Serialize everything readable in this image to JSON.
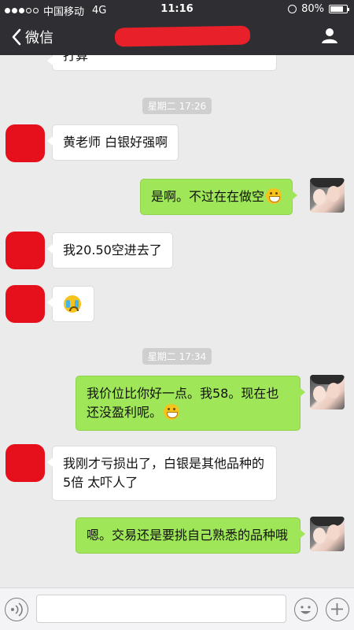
{
  "status_bar": {
    "carrier": "中国移动",
    "network": "4G",
    "time": "11:16",
    "battery": "80%",
    "battery_level": 0.8,
    "signal_icon": "signal-dots-icon",
    "alarm_icon": "alarm-icon",
    "battery_icon": "battery-icon"
  },
  "nav": {
    "back_label": "微信",
    "back_icon": "chevron-left-icon",
    "profile_icon": "person-icon"
  },
  "messages": [
    {
      "text": "打算"
    },
    {
      "timestamp": "星期二 17:26"
    },
    {
      "text": "黄老师 白银好强啊"
    },
    {
      "text": "是啊。不过在在做空"
    },
    {
      "text": "我20.50空进去了"
    },
    {
      "emoji": "crying-face-icon"
    },
    {
      "timestamp": "星期二 17:34"
    },
    {
      "text": "我价位比你好一点。我58。现在也还没盈利呢。"
    },
    {
      "text": "我刚才亏损出了，白银是其他品种的5倍 太吓人了"
    },
    {
      "text": "嗯。交易还是要挑自己熟悉的品种哦"
    }
  ],
  "colors": {
    "bar_bg": "#2f2f33",
    "chat_bg": "#ebebeb",
    "out_bubble": "#9fe658",
    "in_bubble": "#ffffff",
    "redaction": "#e5101b"
  },
  "input_bar": {
    "voice_icon": "voice-icon",
    "emoji_icon": "smiley-icon",
    "plus_icon": "plus-icon"
  }
}
